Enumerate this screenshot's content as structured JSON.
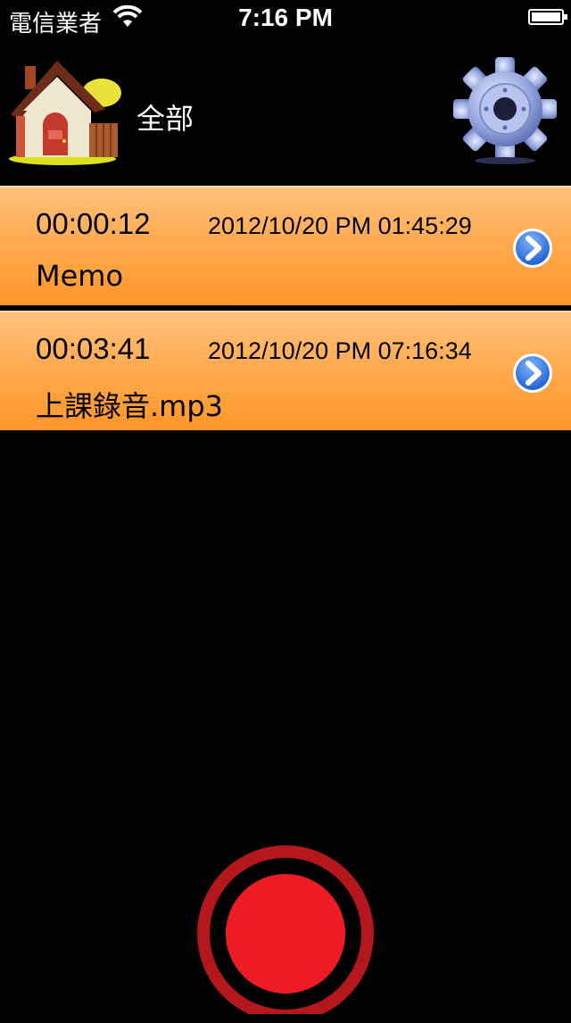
{
  "status_bar": {
    "carrier": "電信業者",
    "time": "7:16 PM"
  },
  "header": {
    "title": "全部",
    "home_icon": "house-icon",
    "settings_icon": "gear-icon"
  },
  "recordings": [
    {
      "duration": "00:00:12",
      "date": "2012/10/20 PM 01:45:29",
      "name": "Memo"
    },
    {
      "duration": "00:03:41",
      "date": "2012/10/20 PM 07:16:34",
      "name": "上課錄音.mp3"
    }
  ],
  "colors": {
    "row_gradient_top": "#ffc27a",
    "row_gradient_bottom": "#ff9628",
    "record_ring": "#b3171c",
    "record_fill": "#ed1c24",
    "disclosure_blue": "#2a74e0"
  }
}
